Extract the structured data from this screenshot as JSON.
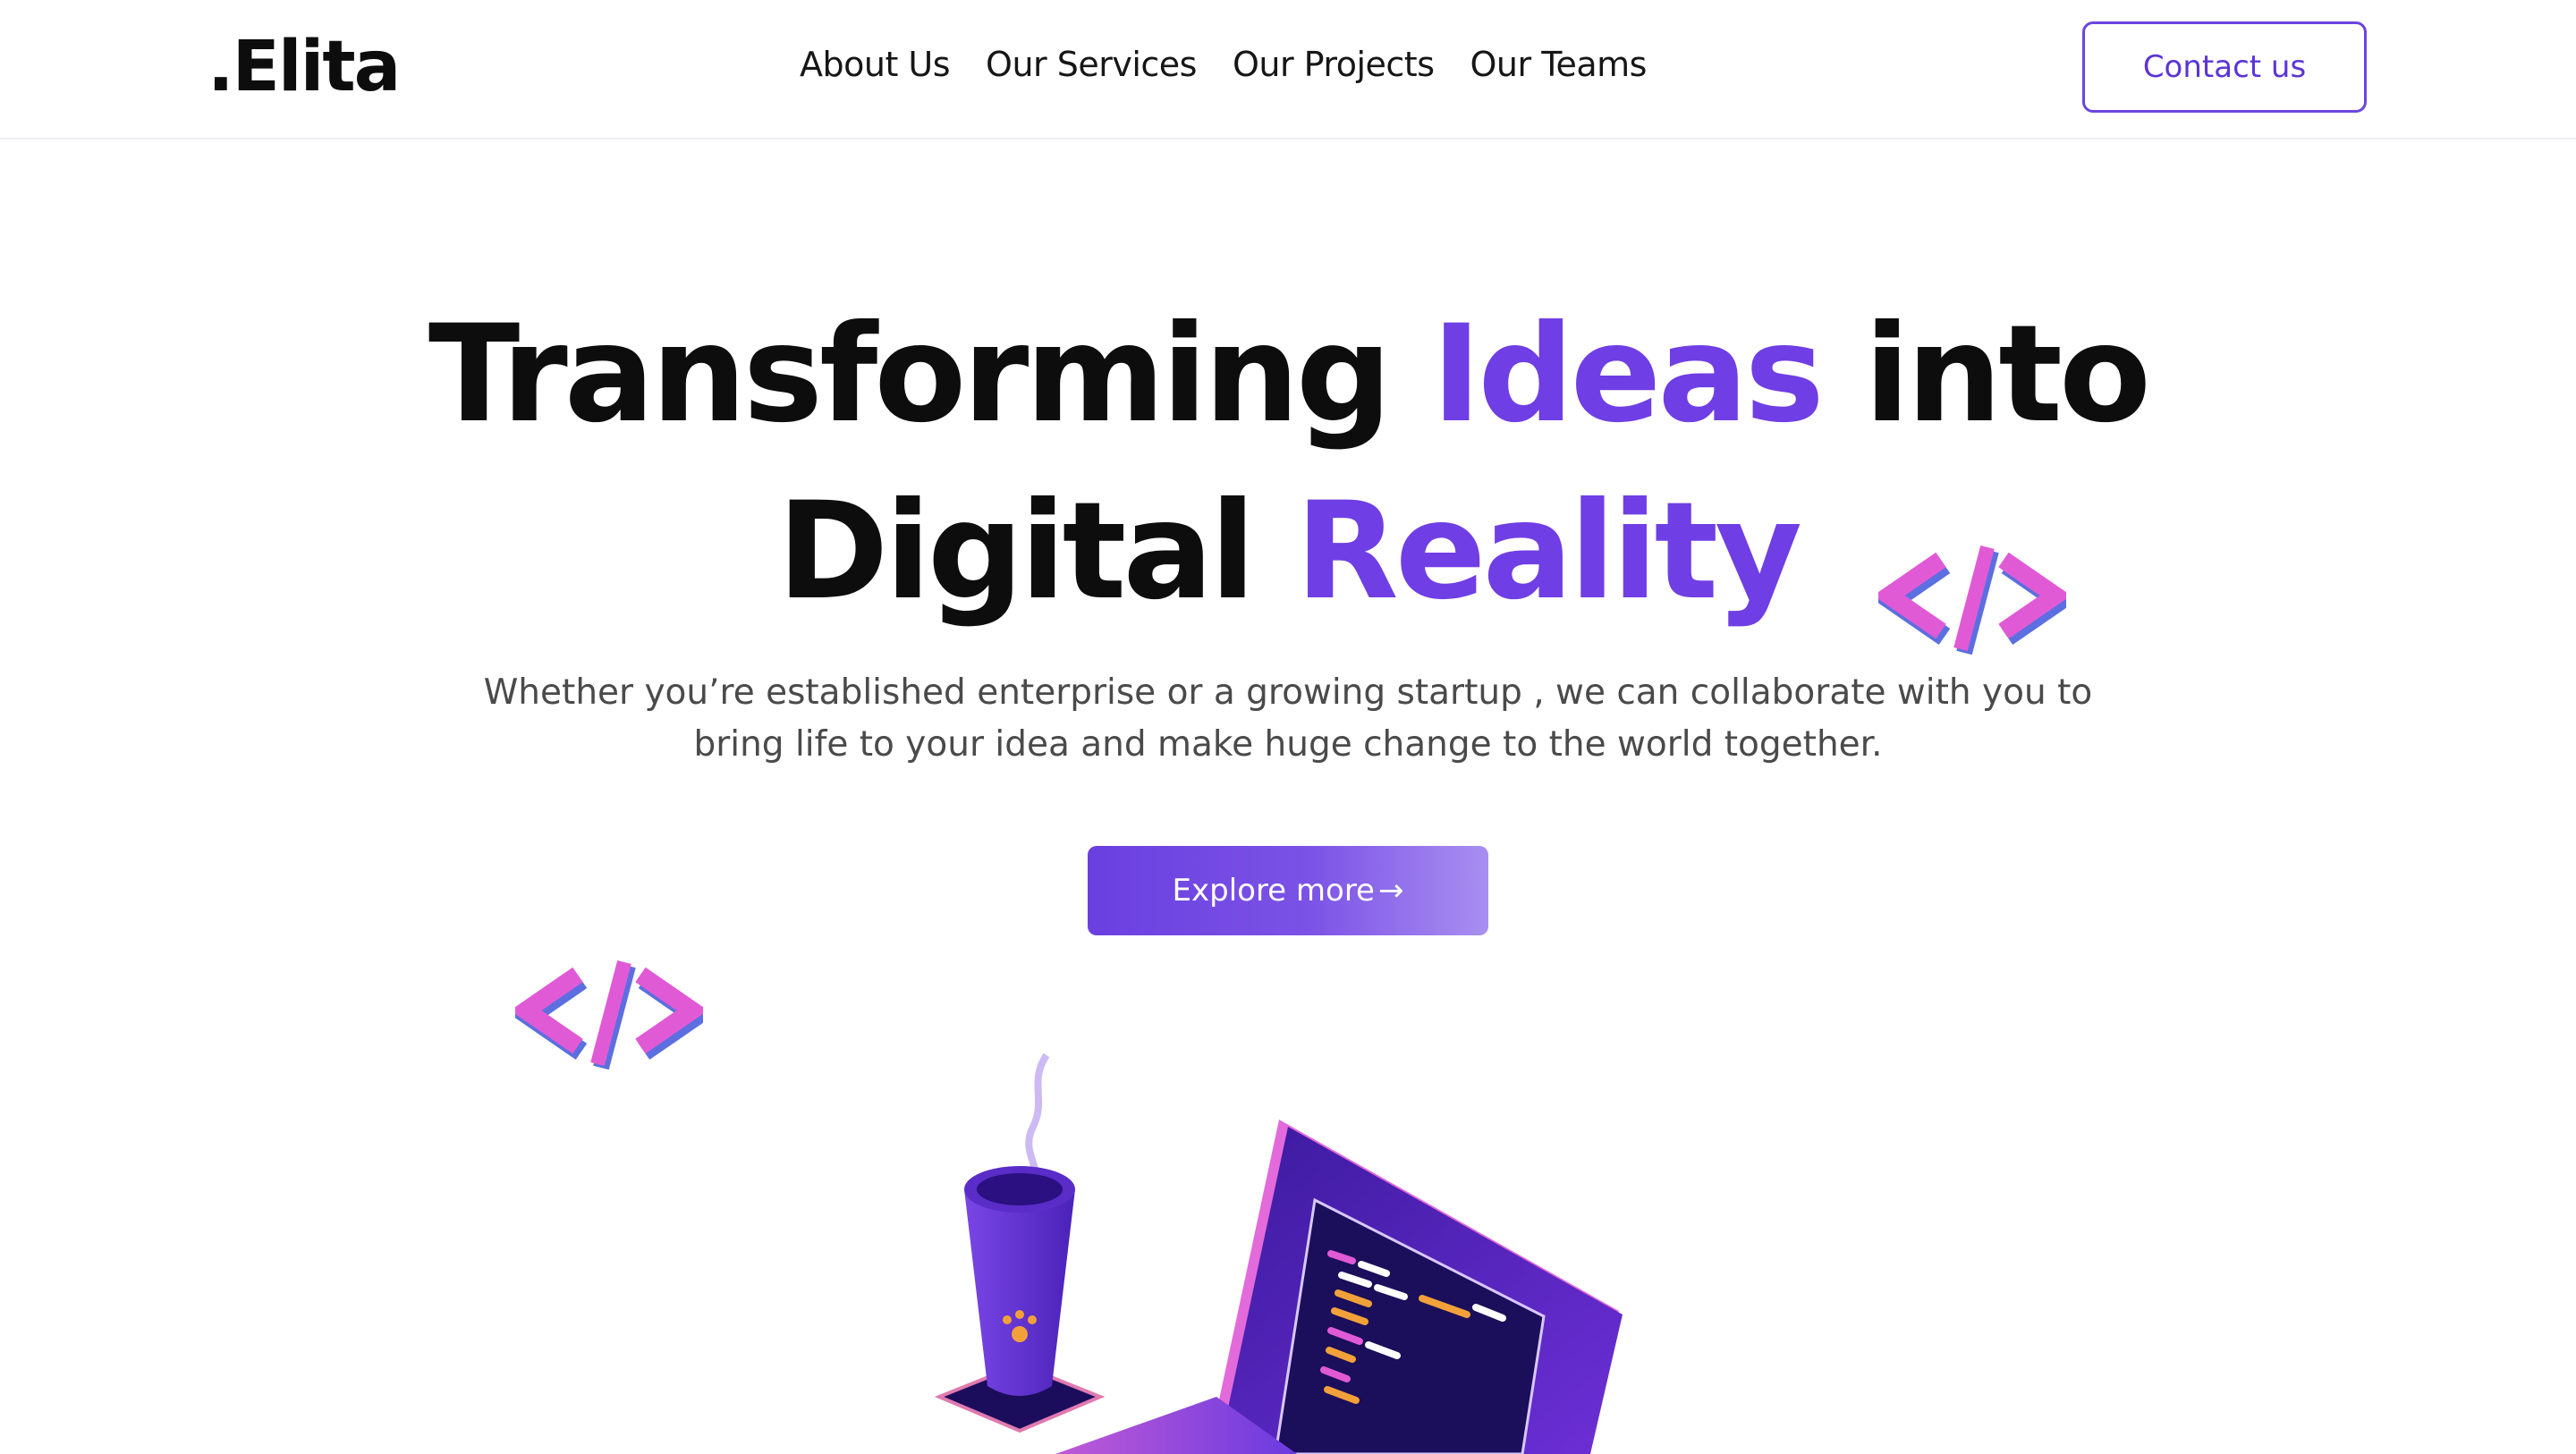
{
  "nav": {
    "logo": ".Elita",
    "items": [
      {
        "label": "About Us"
      },
      {
        "label": "Our Services"
      },
      {
        "label": "Our Projects"
      },
      {
        "label": "Our Teams"
      }
    ],
    "contact_label": "Contact us"
  },
  "hero": {
    "title_1": "Transforming",
    "title_2": "Ideas",
    "title_3": "into",
    "title_4": "Digital",
    "title_5": "Reality",
    "subtitle": "Whether you’re established enterprise or a growing startup , we can collaborate with you to bring life to your idea and make huge change to the world together.",
    "cta_label": "Explore more",
    "cta_arrow": "→"
  },
  "colors": {
    "accent": "#6f3ee4",
    "button_border": "#6c45e0",
    "code_pink": "#e05ad6",
    "code_blue": "#5b6fe0"
  },
  "icons": [
    "code-brackets-icon",
    "arrow-right-icon"
  ]
}
